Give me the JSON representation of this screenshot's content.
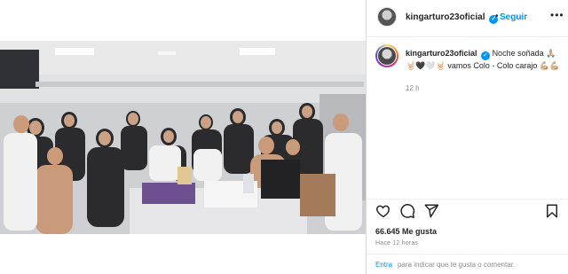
{
  "post": {
    "username": "kingarturo23oficial",
    "follow_label": "Seguir",
    "separator": "•",
    "more_label": "•••",
    "caption_text": "Noche soñada 🙏🏼🤘🏻🖤🤍🤘🏻 vamos Colo - Colo carajo 💪🏼💪🏼",
    "caption_time": "12 h",
    "likes": "66.645 Me gusta",
    "posted_ago": "Hace 12 horas",
    "login_link": "Entra",
    "login_rest": "para indicar que te gusta o comentar."
  },
  "icons": {
    "header_avatar": "profile-avatar",
    "caption_avatar": "profile-avatar-story",
    "verified": "verified-badge-icon",
    "like": "heart-icon",
    "comment": "comment-icon",
    "share": "send-icon",
    "save": "bookmark-icon"
  },
  "colors": {
    "accent": "#0095f6",
    "text": "#262626",
    "muted": "#8e8e8e",
    "border": "#dbdbdb"
  }
}
